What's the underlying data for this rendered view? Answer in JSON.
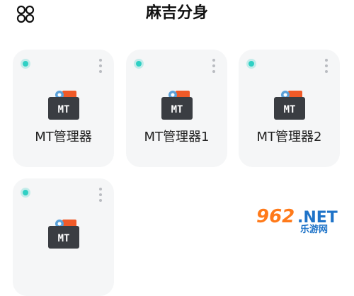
{
  "header": {
    "title": "麻吉分身",
    "menu_icon": "grid-four-circles-icon"
  },
  "cards": [
    {
      "label": "MT管理器",
      "icon_text": "MT",
      "status": "running"
    },
    {
      "label": "MT管理器1",
      "icon_text": "MT",
      "status": "running"
    },
    {
      "label": "MT管理器2",
      "icon_text": "MT",
      "status": "running"
    },
    {
      "label": "",
      "icon_text": "MT",
      "status": "running"
    }
  ],
  "colors": {
    "status_dot": "#2fd0c4",
    "card_bg": "#f5f6f7",
    "mt_icon_dark": "#3a3d42",
    "mt_icon_orange": "#f05a28"
  },
  "watermark": {
    "number": "962",
    "suffix": ".NET",
    "subtitle": "乐游网"
  }
}
